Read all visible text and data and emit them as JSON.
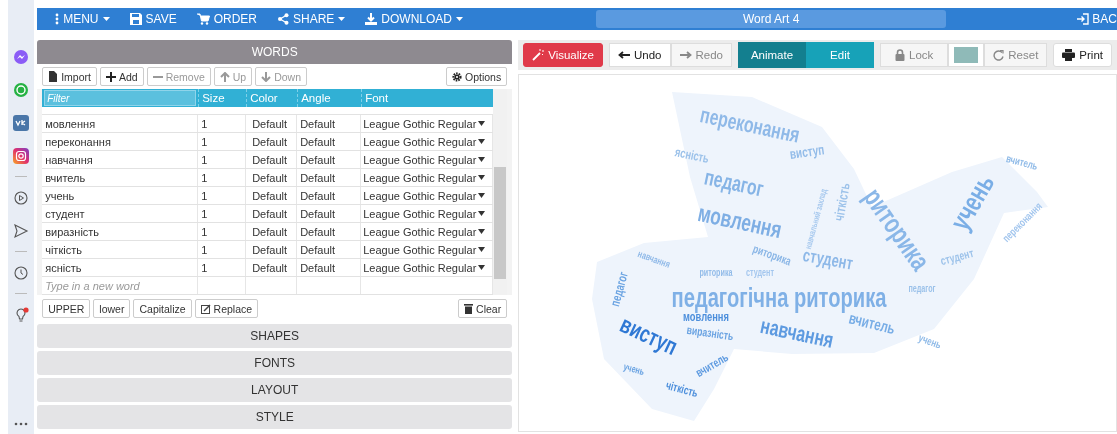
{
  "sidebar": {
    "apps": [
      {
        "kind": "messenger",
        "badge": false
      },
      {
        "kind": "whatsapp",
        "badge": false
      },
      {
        "kind": "vk",
        "badge": false
      },
      {
        "kind": "instagram",
        "badge": false
      },
      {
        "kind": "play",
        "badge": false
      },
      {
        "kind": "send",
        "badge": false
      },
      {
        "kind": "clock",
        "badge": false
      },
      {
        "kind": "bulb",
        "badge": true
      }
    ]
  },
  "top_bar": {
    "menu": [
      {
        "label": "MENU",
        "kind": "menu",
        "caret": true
      },
      {
        "label": "SAVE",
        "kind": "save",
        "caret": false
      },
      {
        "label": "ORDER",
        "kind": "cart",
        "caret": false
      },
      {
        "label": "SHARE",
        "kind": "share",
        "caret": true
      },
      {
        "label": "DOWNLOAD",
        "kind": "download",
        "caret": true
      }
    ],
    "title": "Word Art 4",
    "back": "BAC"
  },
  "words_panel": {
    "title": "WORDS",
    "toolbar": [
      {
        "label": "Import",
        "kind": "import",
        "disabled": false
      },
      {
        "label": "Add",
        "kind": "add",
        "disabled": false
      },
      {
        "label": "Remove",
        "kind": "remove",
        "disabled": true
      },
      {
        "label": "Up",
        "kind": "up",
        "disabled": true
      },
      {
        "label": "Down",
        "kind": "down",
        "disabled": true
      }
    ],
    "options": "Options",
    "filter": {
      "placeholder": "Filter"
    },
    "columns": [
      "Size",
      "Color",
      "Angle",
      "Font"
    ],
    "rows": [
      {
        "word": "мовлення",
        "size": "1",
        "color_label": "Default",
        "angle": "Default",
        "font": "League Gothic Regular"
      },
      {
        "word": "переконання",
        "size": "1",
        "color_label": "Default",
        "angle": "Default",
        "font": "League Gothic Regular"
      },
      {
        "word": "навчання",
        "size": "1",
        "color_label": "Default",
        "angle": "Default",
        "font": "League Gothic Regular"
      },
      {
        "word": "вчитель",
        "size": "1",
        "color_label": "Default",
        "angle": "Default",
        "font": "League Gothic Regular"
      },
      {
        "word": "учень",
        "size": "1",
        "color_label": "Default",
        "angle": "Default",
        "font": "League Gothic Regular"
      },
      {
        "word": "студент",
        "size": "1",
        "color_label": "Default",
        "angle": "Default",
        "font": "League Gothic Regular"
      },
      {
        "word": "виразність",
        "size": "1",
        "color_label": "Default",
        "angle": "Default",
        "font": "League Gothic Regular"
      },
      {
        "word": "чіткість",
        "size": "1",
        "color_label": "Default",
        "angle": "Default",
        "font": "League Gothic Regular"
      },
      {
        "word": "ясність",
        "size": "1",
        "color_label": "Default",
        "angle": "Default",
        "font": "League Gothic Regular"
      }
    ],
    "new_word": {
      "placeholder": "Type in a new word"
    },
    "case_buttons": [
      {
        "label": "UPPER",
        "kind": "text"
      },
      {
        "label": "lower",
        "kind": "text"
      },
      {
        "label": "Capitalize",
        "kind": "text"
      },
      {
        "label": "Replace",
        "kind": "edit"
      }
    ],
    "clear": "Clear"
  },
  "sections": [
    "SHAPES",
    "FONTS",
    "LAYOUT",
    "STYLE"
  ],
  "canvas_toolbar": {
    "visualize": "Visualize",
    "history": [
      {
        "label": "Undo",
        "kind": "undo",
        "disabled": false
      },
      {
        "label": "Redo",
        "kind": "redo",
        "disabled": true
      }
    ],
    "modes": [
      {
        "label": "Animate",
        "selected": true
      },
      {
        "label": "Edit",
        "selected": false
      }
    ],
    "lock": {
      "label": "Lock",
      "disabled": true
    },
    "reset": {
      "label": "Reset",
      "disabled": true
    },
    "print": "Print"
  },
  "word_cloud": {
    "words": [
      "переконання",
      "ясність",
      "педагог",
      "виступ",
      "вчитель",
      "мовлення",
      "навчальний заклад",
      "чіткість",
      "риторика",
      "учень",
      "переконання",
      "навчання",
      "риторика",
      "студент",
      "студент",
      "риторика",
      "студент",
      "педагог",
      "педагогічна риторика",
      "педагог",
      "виступ",
      "мовлення",
      "виразність",
      "навчання",
      "вчитель",
      "учень",
      "вчитель",
      "учень",
      "чіткість"
    ]
  }
}
